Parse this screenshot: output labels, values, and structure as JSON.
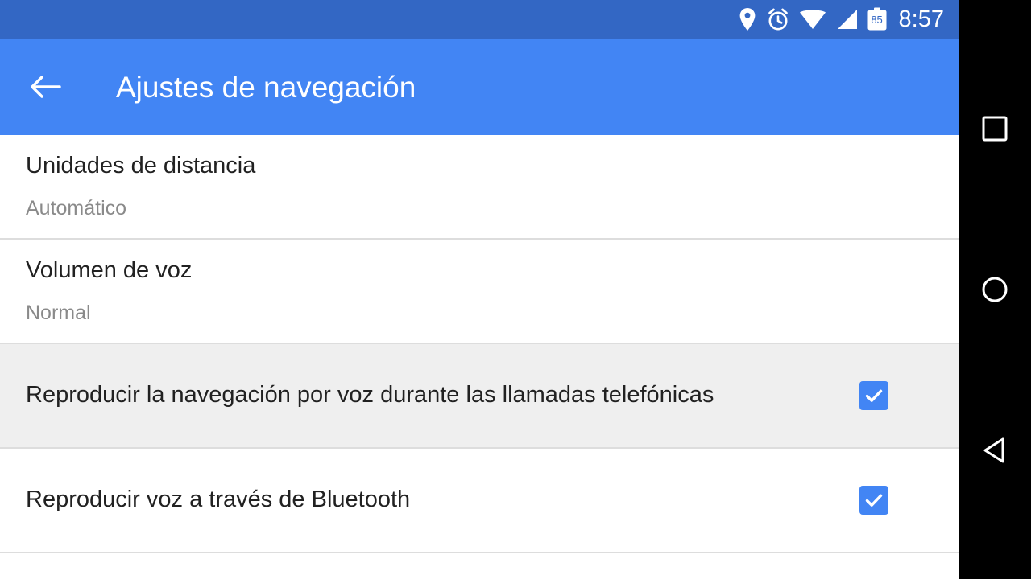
{
  "status_bar": {
    "background_color": "#3367C4",
    "clock": "8:57",
    "battery_level": "85",
    "icons": [
      {
        "name": "location-icon",
        "label": "location"
      },
      {
        "name": "alarm-icon",
        "label": "alarm"
      },
      {
        "name": "wifi-icon",
        "label": "wifi"
      },
      {
        "name": "cellular-signal-icon",
        "label": "cellular signal"
      },
      {
        "name": "battery-icon",
        "label": "battery"
      }
    ]
  },
  "app_bar": {
    "background_color": "#4285F4",
    "title": "Ajustes de navegación",
    "back_button_label": "Atrás"
  },
  "settings": {
    "accent_color": "#4285F4",
    "highlight_color": "#EFEFEF",
    "divider_color": "#DDDDDD",
    "rows": [
      {
        "type": "two-line",
        "name": "distance-units",
        "title": "Unidades de distancia",
        "subtitle": "Automático",
        "highlighted": false
      },
      {
        "type": "two-line",
        "name": "voice-volume",
        "title": "Volumen de voz",
        "subtitle": "Normal",
        "highlighted": false
      },
      {
        "type": "checkbox",
        "name": "play-voice-during-calls",
        "title": "Reproducir la navegación por voz durante las llamadas telefónicas",
        "checked": true,
        "highlighted": true
      },
      {
        "type": "checkbox",
        "name": "play-voice-over-bluetooth",
        "title": "Reproducir voz a través de Bluetooth",
        "checked": true,
        "highlighted": false
      }
    ]
  },
  "nav_bar": {
    "background_color": "#000000",
    "buttons": [
      {
        "name": "recents-button",
        "label": "Recientes"
      },
      {
        "name": "home-button",
        "label": "Inicio"
      },
      {
        "name": "back-button",
        "label": "Atrás"
      }
    ]
  }
}
